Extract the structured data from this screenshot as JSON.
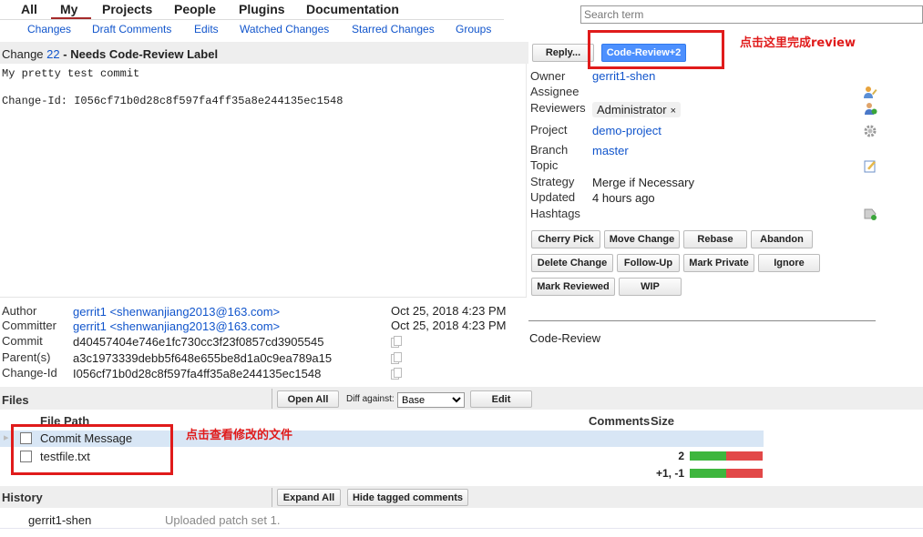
{
  "nav": {
    "top": [
      "All",
      "My",
      "Projects",
      "People",
      "Plugins",
      "Documentation"
    ],
    "sub": [
      "Changes",
      "Draft Comments",
      "Edits",
      "Watched Changes",
      "Starred Changes",
      "Groups"
    ]
  },
  "search": {
    "placeholder": "Search term"
  },
  "change": {
    "prefix": "Change",
    "number": "22",
    "separator": "-",
    "status": "Needs Code-Review Label"
  },
  "header_buttons": {
    "reply": "Reply...",
    "code_review": "Code-Review+2"
  },
  "annotations": {
    "code_review": "点击这里完成review",
    "files": "点击查看修改的文件"
  },
  "commit_message": {
    "line1": "My pretty test commit",
    "line2": "Change-Id: I056cf71b0d28c8f597fa4ff35a8e244135ec1548"
  },
  "info": {
    "owner_label": "Owner",
    "owner": "gerrit1-shen",
    "assignee_label": "Assignee",
    "reviewers_label": "Reviewers",
    "reviewer": "Administrator",
    "reviewer_remove": "×",
    "project_label": "Project",
    "project": "demo-project",
    "branch_label": "Branch",
    "branch": "master",
    "topic_label": "Topic",
    "strategy_label": "Strategy",
    "strategy": "Merge if Necessary",
    "updated_label": "Updated",
    "updated": "4 hours ago",
    "hashtags_label": "Hashtags"
  },
  "actions": {
    "row1": [
      "Cherry Pick",
      "Move Change",
      "Rebase",
      "Abandon"
    ],
    "row2": [
      "Delete Change",
      "Follow-Up",
      "Mark Private",
      "Ignore"
    ],
    "row3": [
      "Mark Reviewed",
      "WIP"
    ]
  },
  "labels_section": {
    "code_review": "Code-Review"
  },
  "meta": {
    "author_label": "Author",
    "author": "gerrit1 <shenwanjiang2013@163.com>",
    "author_date": "Oct 25, 2018 4:23 PM",
    "committer_label": "Committer",
    "committer": "gerrit1 <shenwanjiang2013@163.com>",
    "committer_date": "Oct 25, 2018 4:23 PM",
    "commit_label": "Commit",
    "commit": "d40457404e746e1fc730cc3f23f0857cd3905545",
    "parent_label": "Parent(s)",
    "parent": "a3c1973339debb5f648e655be8d1a0c9ea789a15",
    "changeid_label": "Change-Id",
    "changeid": "I056cf71b0d28c8f597fa4ff35a8e244135ec1548"
  },
  "files": {
    "title": "Files",
    "open_all": "Open All",
    "diff_against_label": "Diff against:",
    "diff_against_value": "Base",
    "edit": "Edit",
    "col_path": "File Path",
    "col_comments": "Comments",
    "col_size": "Size",
    "rows": [
      {
        "name": "Commit Message",
        "size": "2",
        "added_fraction": 0.5
      },
      {
        "name": "testfile.txt",
        "size": "+1, -1",
        "added_fraction": 0.5
      }
    ]
  },
  "history": {
    "title": "History",
    "expand_all": "Expand All",
    "hide_tagged": "Hide tagged comments",
    "entries": [
      {
        "author": "gerrit1-shen",
        "message": "Uploaded patch set 1."
      }
    ]
  },
  "colors": {
    "link": "#1155cc",
    "primary_button": "#4d90fe",
    "annotation": "#e01b1b",
    "highlight_row": "#d8e6f5",
    "bar_added": "#3eb63e",
    "bar_removed": "#e24848",
    "section_bar": "#eeeeee"
  },
  "icons": [
    "edit-assignee-icon",
    "add-reviewer-icon",
    "project-settings-gear-icon",
    "edit-topic-icon",
    "add-hashtag-icon",
    "copy-icon"
  ]
}
